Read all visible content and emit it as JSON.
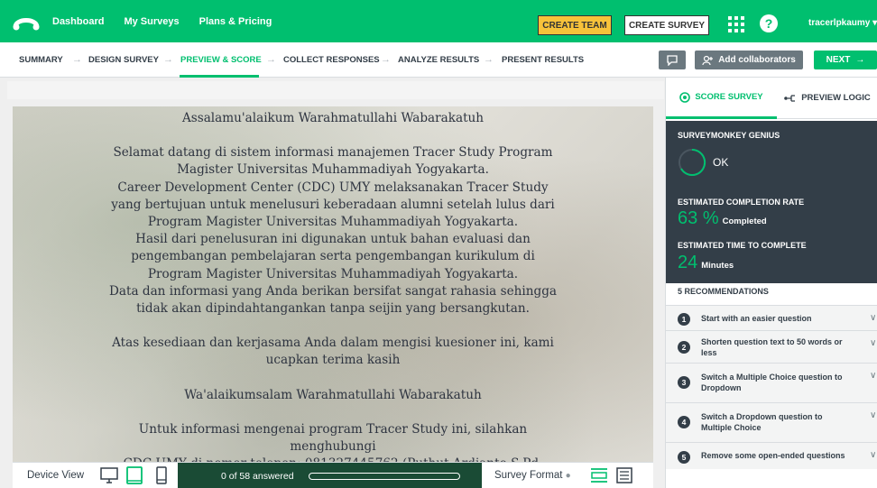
{
  "topnav": {
    "links": [
      "Dashboard",
      "My Surveys",
      "Plans & Pricing"
    ],
    "create_team": "CREATE TEAM",
    "create_survey": "CREATE SURVEY",
    "help": "?",
    "username": "tracerlpkaumy"
  },
  "steps": [
    "SUMMARY",
    "DESIGN SURVEY",
    "PREVIEW & SCORE",
    "COLLECT RESPONSES",
    "ANALYZE RESULTS",
    "PRESENT RESULTS"
  ],
  "active_step": "PREVIEW & SCORE",
  "toolbar": {
    "add_collaborators": "Add collaborators",
    "next": "NEXT"
  },
  "preview": {
    "lines": [
      "Assalamu'alaikum Warahmatullahi Wabarakatuh",
      "",
      "Selamat datang di sistem informasi manajemen Tracer Study Program",
      "Magister Universitas Muhammadiyah Yogyakarta.",
      "Career Development Center (CDC) UMY melaksanakan Tracer Study",
      "yang bertujuan untuk menelusuri keberadaan alumni setelah lulus dari",
      "Program Magister Universitas Muhammadiyah Yogyakarta.",
      "Hasil dari penelusuran ini digunakan untuk bahan evaluasi dan",
      "pengembangan pembelajaran serta pengembangan kurikulum di",
      "Program Magister Universitas Muhammadiyah Yogyakarta.",
      "Data dan informasi yang Anda berikan bersifat sangat rahasia sehingga",
      "tidak akan dipindahtangankan tanpa seijin yang bersangkutan.",
      "",
      "Atas kesediaan dan kerjasama Anda dalam mengisi kuesioner ini, kami",
      "ucapkan terima kasih",
      "",
      "Wa'alaikumsalam Warahmatullahi Wabarakatuh",
      "",
      "Untuk informasi mengenai program Tracer Study ini, silahkan",
      "menghubungi",
      "CDC UMY di nomor telepon: 081327445762 (Puthut Ardianto S.Pd."
    ]
  },
  "bottombar": {
    "device_view_label": "Device View",
    "progress_text": "0 of 58 answered",
    "progress_fraction": 0,
    "survey_format_label": "Survey Format"
  },
  "score_panel": {
    "tab_score": "SCORE SURVEY",
    "tab_logic": "PREVIEW LOGIC",
    "genius_heading": "SURVEYMONKEY GENIUS",
    "genius_status": "OK",
    "completion_heading": "ESTIMATED COMPLETION RATE",
    "completion_value": "63",
    "completion_unit_symbol": "%",
    "completion_unit": "Completed",
    "time_heading": "ESTIMATED TIME TO COMPLETE",
    "time_value": "24",
    "time_unit": "Minutes",
    "recommendations_heading": "5 RECOMMENDATIONS",
    "recommendations": [
      {
        "num": "1",
        "text": "Start with an easier question"
      },
      {
        "num": "2",
        "text": "Shorten question text to 50 words or less"
      },
      {
        "num": "3",
        "text": "Switch a Multiple Choice question to Dropdown"
      },
      {
        "num": "4",
        "text": "Switch a Dropdown question to Multiple Choice"
      },
      {
        "num": "5",
        "text": "Remove some open-ended questions"
      }
    ]
  },
  "colors": {
    "brand_green": "#00bf6f",
    "dark_panel": "#333e48",
    "create_team_yellow": "#f7c23a",
    "progress_dark_green": "#1a4b35"
  },
  "icons": [
    "surveymonkey-logo-icon",
    "apps-grid-icon",
    "help-icon",
    "comment-icon",
    "add-user-icon",
    "arrow-right-icon",
    "desktop-icon",
    "tablet-icon",
    "phone-icon",
    "info-icon",
    "format-one-at-a-time-icon",
    "format-scroll-icon",
    "score-icon",
    "logic-icon",
    "chevron-down-icon"
  ]
}
